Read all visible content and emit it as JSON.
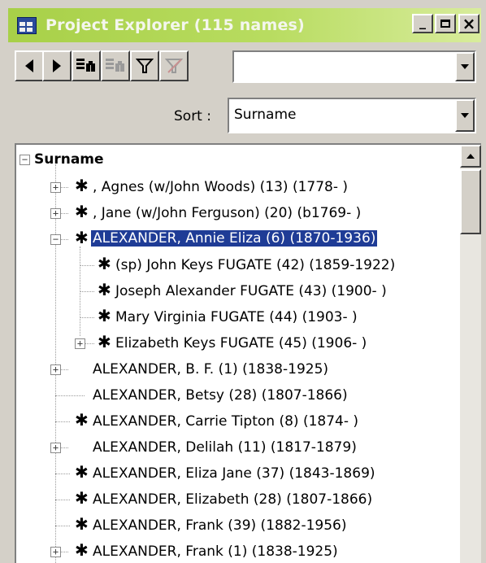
{
  "window": {
    "title": "Project Explorer (115 names)",
    "minimize_label": "_",
    "maximize_label": "□",
    "close_label": "×"
  },
  "toolbar": {
    "icons": [
      "back-arrow-icon",
      "forward-arrow-icon",
      "find-icon",
      "find-disabled-icon",
      "filter-icon",
      "clear-filter-icon"
    ],
    "search_value": ""
  },
  "sort": {
    "label": "Sort :",
    "value": "Surname"
  },
  "tree": {
    "root_label": "Surname",
    "rows": [
      {
        "text": ", Agnes  (w/John Woods) (13) (1778-  )",
        "star": true
      },
      {
        "text": ", Jane  (w/John Ferguson) (20) (b1769-  )",
        "star": true
      },
      {
        "text": "ALEXANDER, Annie Eliza (6) (1870-1936)",
        "star": true,
        "selected": true
      },
      {
        "text": "(sp) John Keys FUGATE (42) (1859-1922)",
        "star": true
      },
      {
        "text": "Joseph Alexander FUGATE (43) (1900-  )",
        "star": true
      },
      {
        "text": "Mary Virginia FUGATE (44) (1903-  )",
        "star": true
      },
      {
        "text": "Elizabeth Keys FUGATE (45) (1906-  )",
        "star": true
      },
      {
        "text": "ALEXANDER, B. F. (1) (1838-1925)",
        "star": false
      },
      {
        "text": "ALEXANDER, Betsy (28) (1807-1866)",
        "star": false
      },
      {
        "text": "ALEXANDER, Carrie Tipton (8) (1874-  )",
        "star": true
      },
      {
        "text": "ALEXANDER, Delilah (11) (1817-1879)",
        "star": false
      },
      {
        "text": "ALEXANDER, Eliza Jane (37) (1843-1869)",
        "star": true
      },
      {
        "text": "ALEXANDER, Elizabeth (28) (1807-1866)",
        "star": true
      },
      {
        "text": "ALEXANDER, Frank (39) (1882-1956)",
        "star": true
      },
      {
        "text": "ALEXANDER, Frank (1) (1838-1925)",
        "star": true
      }
    ],
    "star_glyph": "✱",
    "expand_glyph": "+",
    "collapse_glyph": "−"
  },
  "colors": {
    "title_gradient_start": "#a8d048",
    "selection": "#1f3c96"
  }
}
